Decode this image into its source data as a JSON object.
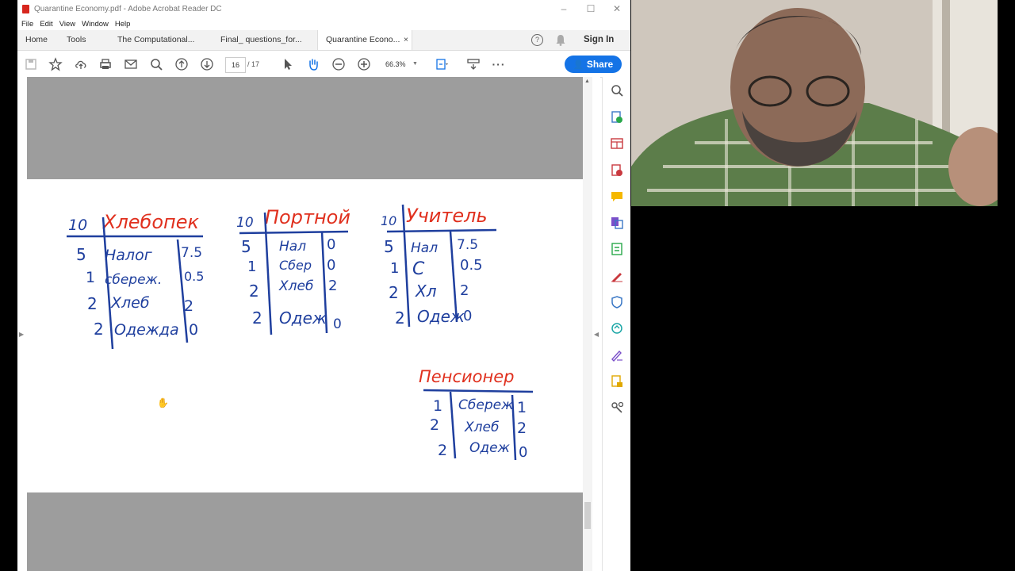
{
  "window": {
    "title": "Quarantine Economy.pdf - Adobe Acrobat Reader DC",
    "controls": {
      "minimize": "–",
      "maximize": "☐",
      "close": "✕"
    }
  },
  "menu": {
    "items": [
      "File",
      "Edit",
      "View",
      "Window",
      "Help"
    ]
  },
  "tabs": {
    "home": "Home",
    "tools": "Tools",
    "docs": [
      "The Computational...",
      "Final_ questions_for...",
      "Quarantine Econo..."
    ],
    "close_glyph": "×",
    "help_glyph": "?",
    "sign_in": "Sign In"
  },
  "toolbar": {
    "current_page": "16",
    "page_separator": "/",
    "total_pages": "17",
    "zoom": "66.3%",
    "share_label": "Share",
    "more": "···"
  },
  "document": {
    "tables": [
      {
        "heading": "Хлебопек",
        "total": "10",
        "rows": [
          {
            "qty": "5",
            "item": "Налог",
            "value": "7.5"
          },
          {
            "qty": "1",
            "item": "сбереж.",
            "value": "0.5"
          },
          {
            "qty": "2",
            "item": "Хлеб",
            "value": "2"
          },
          {
            "qty": "2",
            "item": "Одежда",
            "value": "0"
          }
        ]
      },
      {
        "heading": "Портной",
        "total": "10",
        "rows": [
          {
            "qty": "5",
            "item": "Нал",
            "value": "0"
          },
          {
            "qty": "1",
            "item": "Сбер",
            "value": "0"
          },
          {
            "qty": "2",
            "item": "Хлеб",
            "value": "2"
          },
          {
            "qty": "2",
            "item": "Одеж",
            "value": "0"
          }
        ]
      },
      {
        "heading": "Учитель",
        "total": "10",
        "rows": [
          {
            "qty": "5",
            "item": "Нал",
            "value": "7.5"
          },
          {
            "qty": "1",
            "item": "С",
            "value": "0.5"
          },
          {
            "qty": "2",
            "item": "Хл",
            "value": "2"
          },
          {
            "qty": "2",
            "item": "Одеж",
            "value": "0"
          }
        ]
      },
      {
        "heading": "Пенсионер",
        "total": "",
        "rows": [
          {
            "qty": "1",
            "item": "Сбереж",
            "value": "1"
          },
          {
            "qty": "2",
            "item": "Хлеб",
            "value": "2"
          },
          {
            "qty": "2",
            "item": "Одеж",
            "value": "0"
          }
        ]
      }
    ]
  },
  "colors": {
    "ink_blue": "#1f3f9e",
    "ink_red": "#e0301e",
    "accent": "#1473e6",
    "pdf_red": "#d7261e"
  },
  "right_tools": [
    "search-zoom-icon",
    "export-pdf-icon",
    "organize-pages-icon",
    "create-pdf-icon",
    "comment-icon",
    "edit-pdf-icon",
    "compress-icon",
    "fill-sign-icon",
    "protect-icon",
    "send-for-review-icon",
    "sign-icon",
    "stamp-icon",
    "more-tools-icon"
  ]
}
